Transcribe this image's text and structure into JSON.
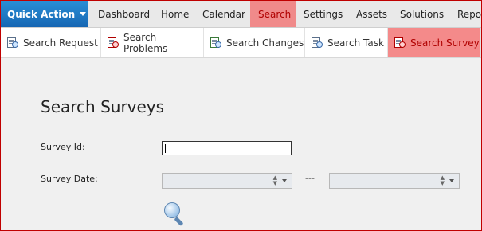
{
  "topnav": {
    "quick_action": "Quick Action",
    "items": [
      {
        "label": "Dashboard"
      },
      {
        "label": "Home"
      },
      {
        "label": "Calendar"
      },
      {
        "label": "Search"
      },
      {
        "label": "Settings"
      },
      {
        "label": "Assets"
      },
      {
        "label": "Solutions"
      },
      {
        "label": "Repor"
      }
    ],
    "active": "Search"
  },
  "subnav": {
    "items": [
      {
        "label": "Search Request",
        "icon": "search-doc-icon"
      },
      {
        "label": "Search Problems",
        "icon": "search-doc-icon"
      },
      {
        "label": "Search Changes",
        "icon": "search-doc-icon"
      },
      {
        "label": "Search Task",
        "icon": "search-doc-icon"
      },
      {
        "label": "Search Survey",
        "icon": "search-doc-icon"
      }
    ],
    "active": "Search Survey"
  },
  "form": {
    "title": "Search Surveys",
    "survey_id_label": "Survey Id:",
    "survey_id_value": "",
    "survey_date_label": "Survey Date:",
    "date_from": "",
    "date_to": "",
    "date_separator": "---"
  },
  "colors": {
    "accent_blue": "#1a73c4",
    "active_red_bg": "#f08a8a",
    "active_red_text": "#b00000",
    "frame_border": "#c00000"
  }
}
